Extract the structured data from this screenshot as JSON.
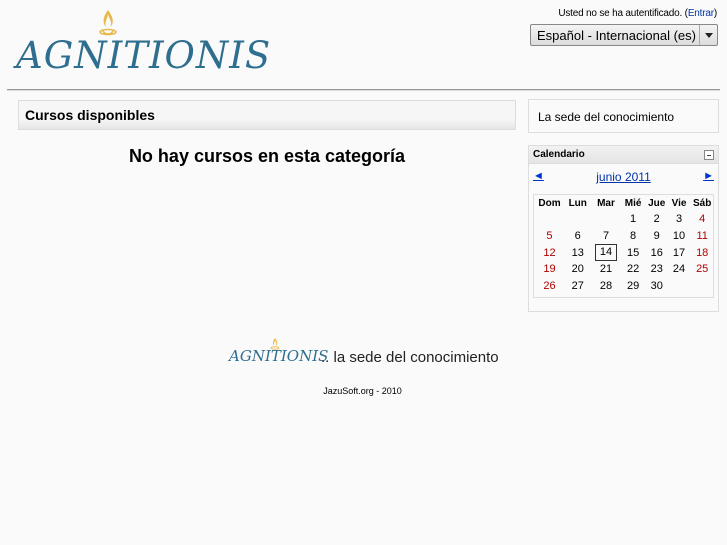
{
  "header": {
    "logo_text": "AGNITIONIS",
    "login_text": "Usted no se ha autentificado.",
    "login_link": "Entrar",
    "language_selected": "Español - Internacional (es)"
  },
  "main": {
    "courses_title": "Cursos disponibles",
    "no_courses": "No hay cursos en esta categoría"
  },
  "sidebar": {
    "tagline": "La sede del conocimiento",
    "calendar": {
      "title": "Calendario",
      "month": "junio 2011",
      "prev": "◄",
      "next": "►",
      "weekdays": [
        "Dom",
        "Lun",
        "Mar",
        "Mié",
        "Jue",
        "Vie",
        "Sáb"
      ],
      "weeks": [
        [
          "",
          "",
          "",
          "1",
          "2",
          "3",
          "4"
        ],
        [
          "5",
          "6",
          "7",
          "8",
          "9",
          "10",
          "11"
        ],
        [
          "12",
          "13",
          "14",
          "15",
          "16",
          "17",
          "18"
        ],
        [
          "19",
          "20",
          "21",
          "22",
          "23",
          "24",
          "25"
        ],
        [
          "26",
          "27",
          "28",
          "29",
          "30",
          "",
          ""
        ]
      ],
      "today": "14",
      "weekend_color": "#b00000"
    }
  },
  "footer": {
    "logo_text": "AGNITIONIS",
    "tagline": ".. la sede del conocimiento",
    "copyright": "JazuSoft.org - 2010"
  },
  "colors": {
    "brand": "#2e6e8e",
    "flame": "#e8b84a",
    "link": "#0033aa"
  }
}
